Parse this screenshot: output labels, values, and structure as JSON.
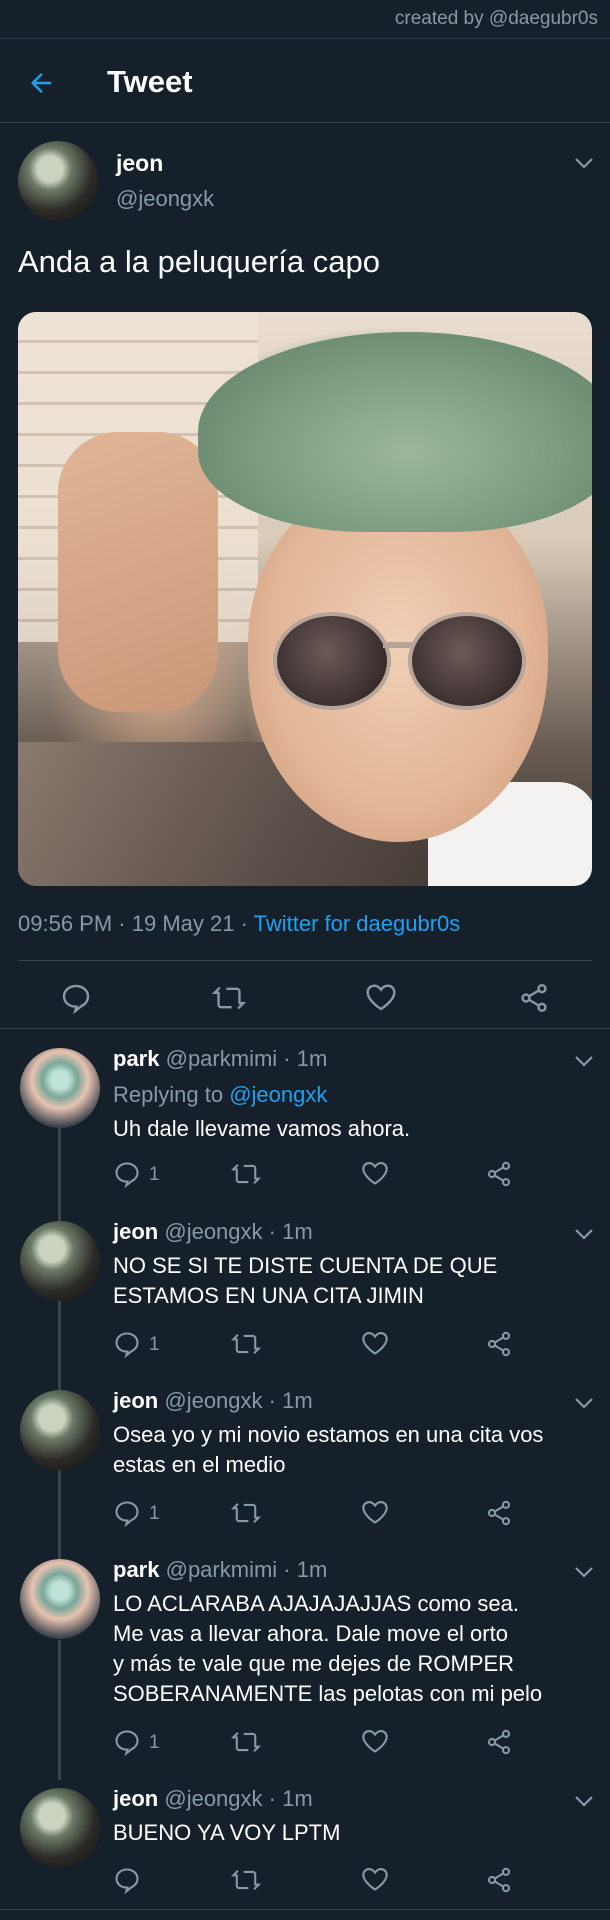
{
  "credit": "created by @daegubr0s",
  "header": {
    "title": "Tweet",
    "back_icon": "arrow-left-icon",
    "accent": "#1da1f2"
  },
  "main_tweet": {
    "name": "jeon",
    "handle": "@jeongxk",
    "text": "Anda a la peluquería capo",
    "time": "09:56 PM",
    "date": "19 May 21",
    "source": "Twitter for daegubr0s"
  },
  "replies": [
    {
      "name": "park",
      "handle": "@parkmimi",
      "time": "1m",
      "replying_label": "Replying to",
      "replying_to": "@jeongxk",
      "lines": [
        "Uh dale llevame vamos ahora."
      ],
      "reply_count": "1"
    },
    {
      "name": "jeon",
      "handle": "@jeongxk",
      "time": "1m",
      "lines": [
        "NO SE SI TE DISTE CUENTA DE QUE",
        "ESTAMOS EN UNA CITA JIMIN"
      ],
      "reply_count": "1"
    },
    {
      "name": "jeon",
      "handle": "@jeongxk",
      "time": "1m",
      "lines": [
        "Osea yo y mi novio estamos en una cita vos",
        "estas en el medio"
      ],
      "reply_count": "1"
    },
    {
      "name": "park",
      "handle": "@parkmimi",
      "time": "1m",
      "lines": [
        "LO ACLARABA AJAJAJAJJAS como sea.",
        "Me vas a llevar ahora. Dale move el orto",
        "y más te vale que me dejes de ROMPER",
        "SOBERANAMENTE las pelotas con mi pelo"
      ],
      "reply_count": "1"
    },
    {
      "name": "jeon",
      "handle": "@jeongxk",
      "time": "1m",
      "lines": [
        "BUENO YA VOY LPTM"
      ],
      "reply_count": ""
    }
  ],
  "sep": " · "
}
